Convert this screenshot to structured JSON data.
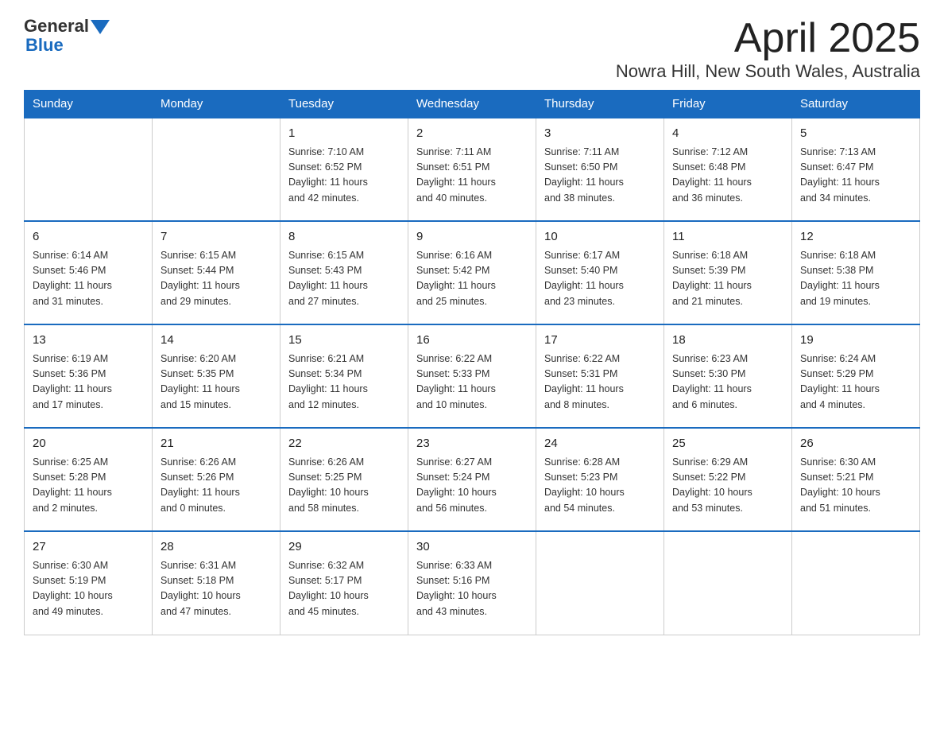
{
  "header": {
    "logo_general": "General",
    "logo_blue": "Blue",
    "month": "April 2025",
    "location": "Nowra Hill, New South Wales, Australia"
  },
  "days_of_week": [
    "Sunday",
    "Monday",
    "Tuesday",
    "Wednesday",
    "Thursday",
    "Friday",
    "Saturday"
  ],
  "weeks": [
    [
      {
        "day": "",
        "info": ""
      },
      {
        "day": "",
        "info": ""
      },
      {
        "day": "1",
        "info": "Sunrise: 7:10 AM\nSunset: 6:52 PM\nDaylight: 11 hours\nand 42 minutes."
      },
      {
        "day": "2",
        "info": "Sunrise: 7:11 AM\nSunset: 6:51 PM\nDaylight: 11 hours\nand 40 minutes."
      },
      {
        "day": "3",
        "info": "Sunrise: 7:11 AM\nSunset: 6:50 PM\nDaylight: 11 hours\nand 38 minutes."
      },
      {
        "day": "4",
        "info": "Sunrise: 7:12 AM\nSunset: 6:48 PM\nDaylight: 11 hours\nand 36 minutes."
      },
      {
        "day": "5",
        "info": "Sunrise: 7:13 AM\nSunset: 6:47 PM\nDaylight: 11 hours\nand 34 minutes."
      }
    ],
    [
      {
        "day": "6",
        "info": "Sunrise: 6:14 AM\nSunset: 5:46 PM\nDaylight: 11 hours\nand 31 minutes."
      },
      {
        "day": "7",
        "info": "Sunrise: 6:15 AM\nSunset: 5:44 PM\nDaylight: 11 hours\nand 29 minutes."
      },
      {
        "day": "8",
        "info": "Sunrise: 6:15 AM\nSunset: 5:43 PM\nDaylight: 11 hours\nand 27 minutes."
      },
      {
        "day": "9",
        "info": "Sunrise: 6:16 AM\nSunset: 5:42 PM\nDaylight: 11 hours\nand 25 minutes."
      },
      {
        "day": "10",
        "info": "Sunrise: 6:17 AM\nSunset: 5:40 PM\nDaylight: 11 hours\nand 23 minutes."
      },
      {
        "day": "11",
        "info": "Sunrise: 6:18 AM\nSunset: 5:39 PM\nDaylight: 11 hours\nand 21 minutes."
      },
      {
        "day": "12",
        "info": "Sunrise: 6:18 AM\nSunset: 5:38 PM\nDaylight: 11 hours\nand 19 minutes."
      }
    ],
    [
      {
        "day": "13",
        "info": "Sunrise: 6:19 AM\nSunset: 5:36 PM\nDaylight: 11 hours\nand 17 minutes."
      },
      {
        "day": "14",
        "info": "Sunrise: 6:20 AM\nSunset: 5:35 PM\nDaylight: 11 hours\nand 15 minutes."
      },
      {
        "day": "15",
        "info": "Sunrise: 6:21 AM\nSunset: 5:34 PM\nDaylight: 11 hours\nand 12 minutes."
      },
      {
        "day": "16",
        "info": "Sunrise: 6:22 AM\nSunset: 5:33 PM\nDaylight: 11 hours\nand 10 minutes."
      },
      {
        "day": "17",
        "info": "Sunrise: 6:22 AM\nSunset: 5:31 PM\nDaylight: 11 hours\nand 8 minutes."
      },
      {
        "day": "18",
        "info": "Sunrise: 6:23 AM\nSunset: 5:30 PM\nDaylight: 11 hours\nand 6 minutes."
      },
      {
        "day": "19",
        "info": "Sunrise: 6:24 AM\nSunset: 5:29 PM\nDaylight: 11 hours\nand 4 minutes."
      }
    ],
    [
      {
        "day": "20",
        "info": "Sunrise: 6:25 AM\nSunset: 5:28 PM\nDaylight: 11 hours\nand 2 minutes."
      },
      {
        "day": "21",
        "info": "Sunrise: 6:26 AM\nSunset: 5:26 PM\nDaylight: 11 hours\nand 0 minutes."
      },
      {
        "day": "22",
        "info": "Sunrise: 6:26 AM\nSunset: 5:25 PM\nDaylight: 10 hours\nand 58 minutes."
      },
      {
        "day": "23",
        "info": "Sunrise: 6:27 AM\nSunset: 5:24 PM\nDaylight: 10 hours\nand 56 minutes."
      },
      {
        "day": "24",
        "info": "Sunrise: 6:28 AM\nSunset: 5:23 PM\nDaylight: 10 hours\nand 54 minutes."
      },
      {
        "day": "25",
        "info": "Sunrise: 6:29 AM\nSunset: 5:22 PM\nDaylight: 10 hours\nand 53 minutes."
      },
      {
        "day": "26",
        "info": "Sunrise: 6:30 AM\nSunset: 5:21 PM\nDaylight: 10 hours\nand 51 minutes."
      }
    ],
    [
      {
        "day": "27",
        "info": "Sunrise: 6:30 AM\nSunset: 5:19 PM\nDaylight: 10 hours\nand 49 minutes."
      },
      {
        "day": "28",
        "info": "Sunrise: 6:31 AM\nSunset: 5:18 PM\nDaylight: 10 hours\nand 47 minutes."
      },
      {
        "day": "29",
        "info": "Sunrise: 6:32 AM\nSunset: 5:17 PM\nDaylight: 10 hours\nand 45 minutes."
      },
      {
        "day": "30",
        "info": "Sunrise: 6:33 AM\nSunset: 5:16 PM\nDaylight: 10 hours\nand 43 minutes."
      },
      {
        "day": "",
        "info": ""
      },
      {
        "day": "",
        "info": ""
      },
      {
        "day": "",
        "info": ""
      }
    ]
  ]
}
